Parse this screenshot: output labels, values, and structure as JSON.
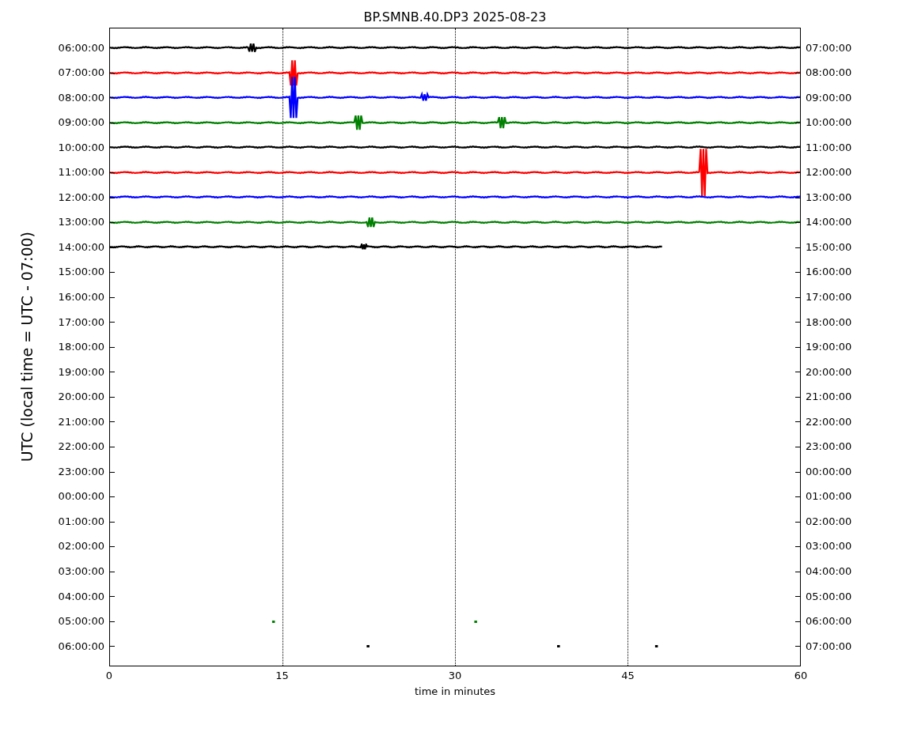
{
  "title": "BP.SMNB.40.DP3 2025-08-23",
  "ylabel": "UTC (local time = UTC - 07:00)",
  "xlabel": "time in minutes",
  "xticks": [
    "0",
    "15",
    "30",
    "45",
    "60"
  ],
  "rows": [
    {
      "left": "06:00:00",
      "right": "07:00:00",
      "trace": {
        "kind": "line",
        "color": "#000000",
        "level": 1
      }
    },
    {
      "left": "07:00:00",
      "right": "08:00:00",
      "trace": {
        "kind": "line",
        "color": "#ff0000",
        "level": 1
      }
    },
    {
      "left": "08:00:00",
      "right": "09:00:00",
      "trace": {
        "kind": "line",
        "color": "#0000ff",
        "level": 1
      }
    },
    {
      "left": "09:00:00",
      "right": "10:00:00",
      "trace": {
        "kind": "line",
        "color": "#008000",
        "level": 1
      }
    },
    {
      "left": "10:00:00",
      "right": "11:00:00",
      "trace": {
        "kind": "line",
        "color": "#000000",
        "level": 1
      }
    },
    {
      "left": "11:00:00",
      "right": "12:00:00",
      "trace": {
        "kind": "line",
        "color": "#ff0000",
        "level": 1
      }
    },
    {
      "left": "12:00:00",
      "right": "13:00:00",
      "trace": {
        "kind": "line",
        "color": "#0000ff",
        "level": 1
      }
    },
    {
      "left": "13:00:00",
      "right": "14:00:00",
      "trace": {
        "kind": "line",
        "color": "#008000",
        "level": 1
      }
    },
    {
      "left": "14:00:00",
      "right": "15:00:00",
      "trace": {
        "kind": "line",
        "color": "#000000",
        "level": 0.8
      }
    },
    {
      "left": "15:00:00",
      "right": "16:00:00"
    },
    {
      "left": "16:00:00",
      "right": "17:00:00"
    },
    {
      "left": "17:00:00",
      "right": "18:00:00"
    },
    {
      "left": "18:00:00",
      "right": "19:00:00"
    },
    {
      "left": "19:00:00",
      "right": "20:00:00"
    },
    {
      "left": "20:00:00",
      "right": "21:00:00"
    },
    {
      "left": "21:00:00",
      "right": "22:00:00"
    },
    {
      "left": "22:00:00",
      "right": "23:00:00"
    },
    {
      "left": "23:00:00",
      "right": "00:00:00"
    },
    {
      "left": "00:00:00",
      "right": "01:00:00"
    },
    {
      "left": "01:00:00",
      "right": "02:00:00"
    },
    {
      "left": "02:00:00",
      "right": "03:00:00"
    },
    {
      "left": "03:00:00",
      "right": "04:00:00"
    },
    {
      "left": "04:00:00",
      "right": "05:00:00"
    },
    {
      "left": "05:00:00",
      "right": "06:00:00",
      "trace": {
        "kind": "dots",
        "color": "#008000"
      }
    },
    {
      "left": "06:00:00",
      "right": "07:00:00",
      "trace": {
        "kind": "dots",
        "color": "#000000"
      }
    }
  ]
}
